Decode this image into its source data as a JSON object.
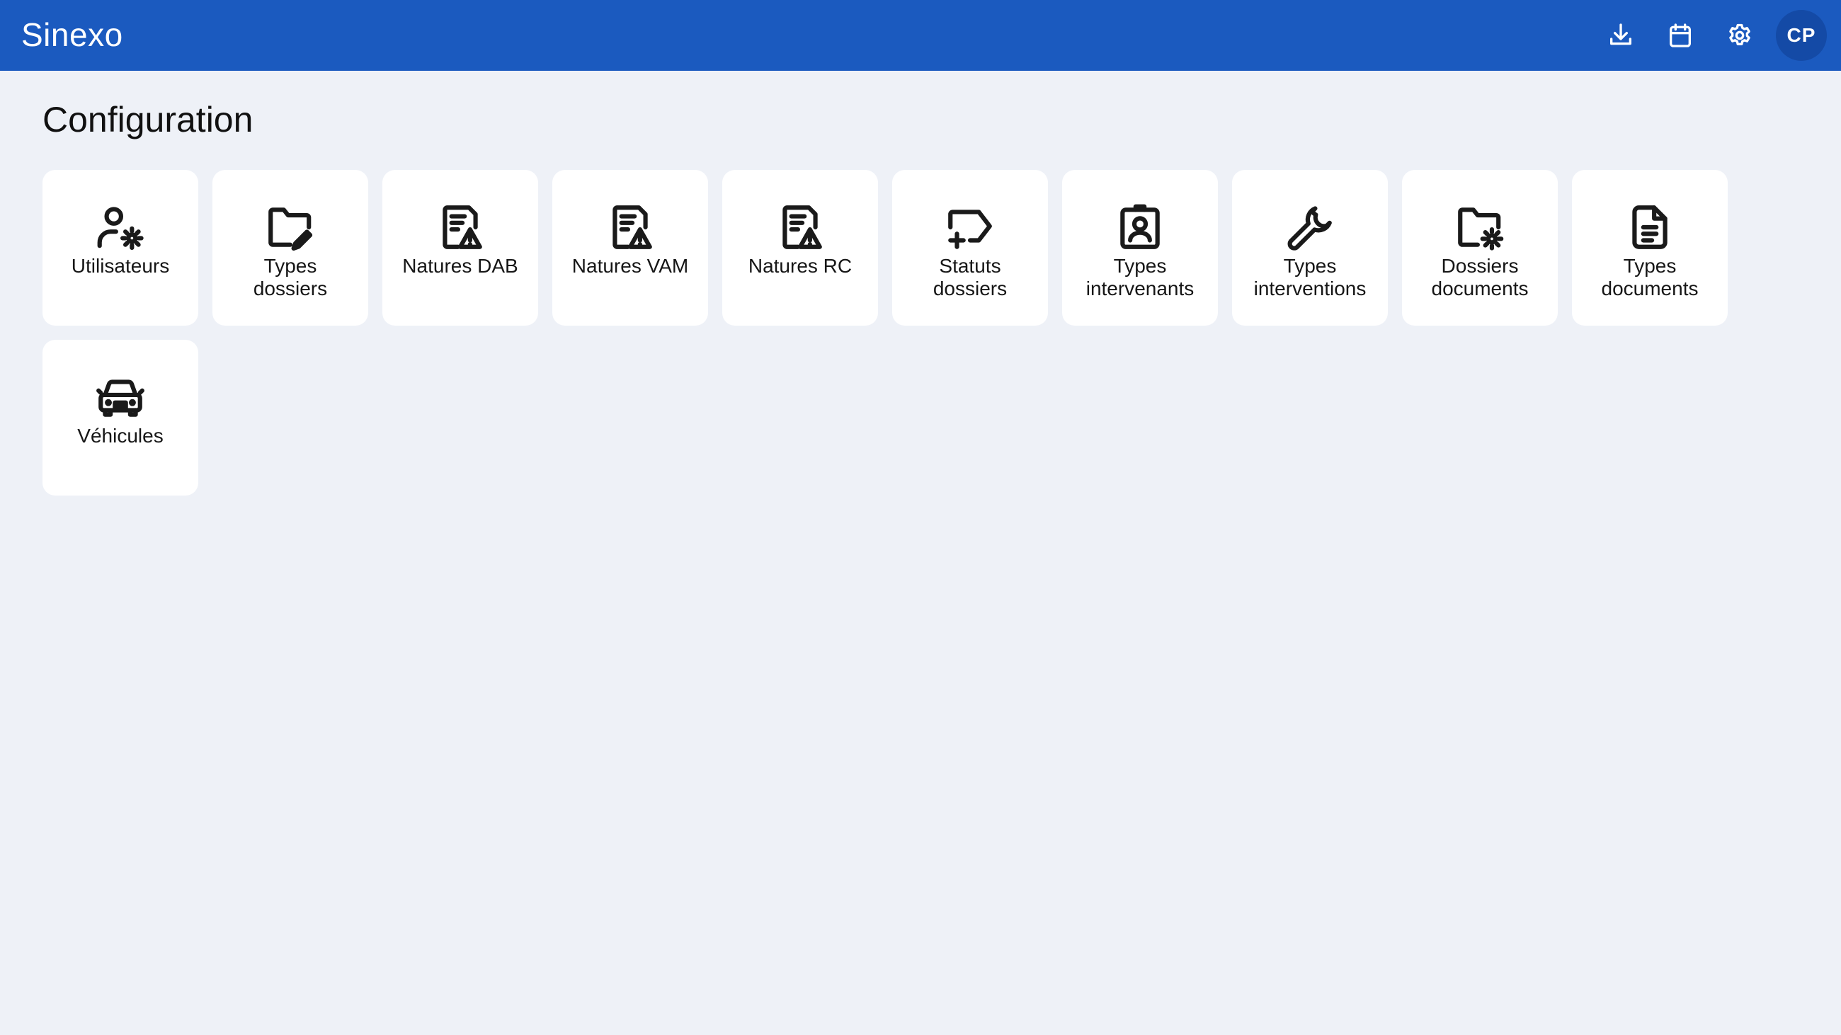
{
  "app": {
    "title": "Sinexo"
  },
  "header_actions": {
    "download_icon": "download-icon",
    "calendar_icon": "calendar-icon",
    "settings_icon": "gear-icon",
    "avatar_initials": "CP"
  },
  "colors": {
    "topbar": "#1b5abf",
    "avatar_bg": "#144aa6",
    "background": "#eef1f7",
    "tile": "#ffffff"
  },
  "page": {
    "title": "Configuration"
  },
  "tiles": [
    {
      "label": "Utilisateurs",
      "icon": "user-gear-icon"
    },
    {
      "label": "Types\ndossiers",
      "icon": "folder-edit-icon"
    },
    {
      "label": "Natures DAB",
      "icon": "document-warning-icon"
    },
    {
      "label": "Natures VAM",
      "icon": "document-warning-icon"
    },
    {
      "label": "Natures RC",
      "icon": "document-warning-icon"
    },
    {
      "label": "Statuts\ndossiers",
      "icon": "tag-plus-icon"
    },
    {
      "label": "Types\nintervenants",
      "icon": "badge-user-icon"
    },
    {
      "label": "Types\ninterventions",
      "icon": "wrench-icon"
    },
    {
      "label": "Dossiers\ndocuments",
      "icon": "folder-gear-icon"
    },
    {
      "label": "Types\ndocuments",
      "icon": "document-icon"
    },
    {
      "label": "Véhicules",
      "icon": "car-icon"
    }
  ]
}
